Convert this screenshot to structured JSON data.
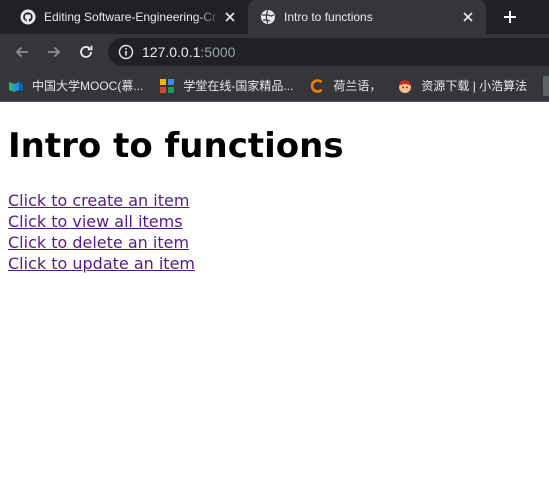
{
  "tabs": [
    {
      "title": "Editing Software-Engineering-Cr",
      "favicon": "github-icon",
      "active": false
    },
    {
      "title": "Intro to functions",
      "favicon": "globe-icon",
      "active": true
    }
  ],
  "toolbar": {
    "url_host": "127.0.0.1",
    "url_port": ":5000"
  },
  "bookmarks": [
    {
      "label": "中国大学MOOC(慕...",
      "icon": "mooc-icon"
    },
    {
      "label": "学堂在线-国家精品...",
      "icon": "xuetang-icon"
    },
    {
      "label": "荷兰语，",
      "icon": "c-icon"
    },
    {
      "label": "资源下载 | 小浩算法",
      "icon": "avatar-icon"
    }
  ],
  "page": {
    "heading": "Intro to functions",
    "links": [
      "Click to create an item",
      "Click to view all items",
      "Click to delete an item",
      "Click to update an item"
    ]
  },
  "colors": {
    "tabstrip": "#202124",
    "toolbar": "#35363a",
    "link_visited": "#551a8b"
  }
}
